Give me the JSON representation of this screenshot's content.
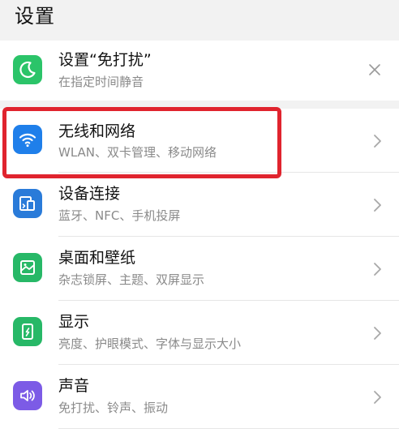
{
  "header": {
    "title": "设置"
  },
  "colors": {
    "dnd_icon": "#2bc469",
    "wlan_icon": "#1f7fea",
    "device_icon": "#2a7bd9",
    "wallpaper_icon": "#27b867",
    "display_icon": "#27b867",
    "sound_icon": "#7c5be6",
    "highlight": "#e0242e"
  },
  "dnd": {
    "title": "设置“免打扰”",
    "subtitle": "在指定时间静音",
    "icon": "moon-icon"
  },
  "items": [
    {
      "title": "无线和网络",
      "subtitle": "WLAN、双卡管理、移动网络",
      "icon": "wifi-icon"
    },
    {
      "title": "设备连接",
      "subtitle": "蓝牙、NFC、手机投屏",
      "icon": "device-connect-icon"
    },
    {
      "title": "桌面和壁纸",
      "subtitle": "杂志锁屏、主题、双屏显示",
      "icon": "wallpaper-icon"
    },
    {
      "title": "显示",
      "subtitle": "亮度、护眼模式、字体与显示大小",
      "icon": "display-icon"
    },
    {
      "title": "声音",
      "subtitle": "免打扰、铃声、振动",
      "icon": "speaker-icon"
    }
  ]
}
